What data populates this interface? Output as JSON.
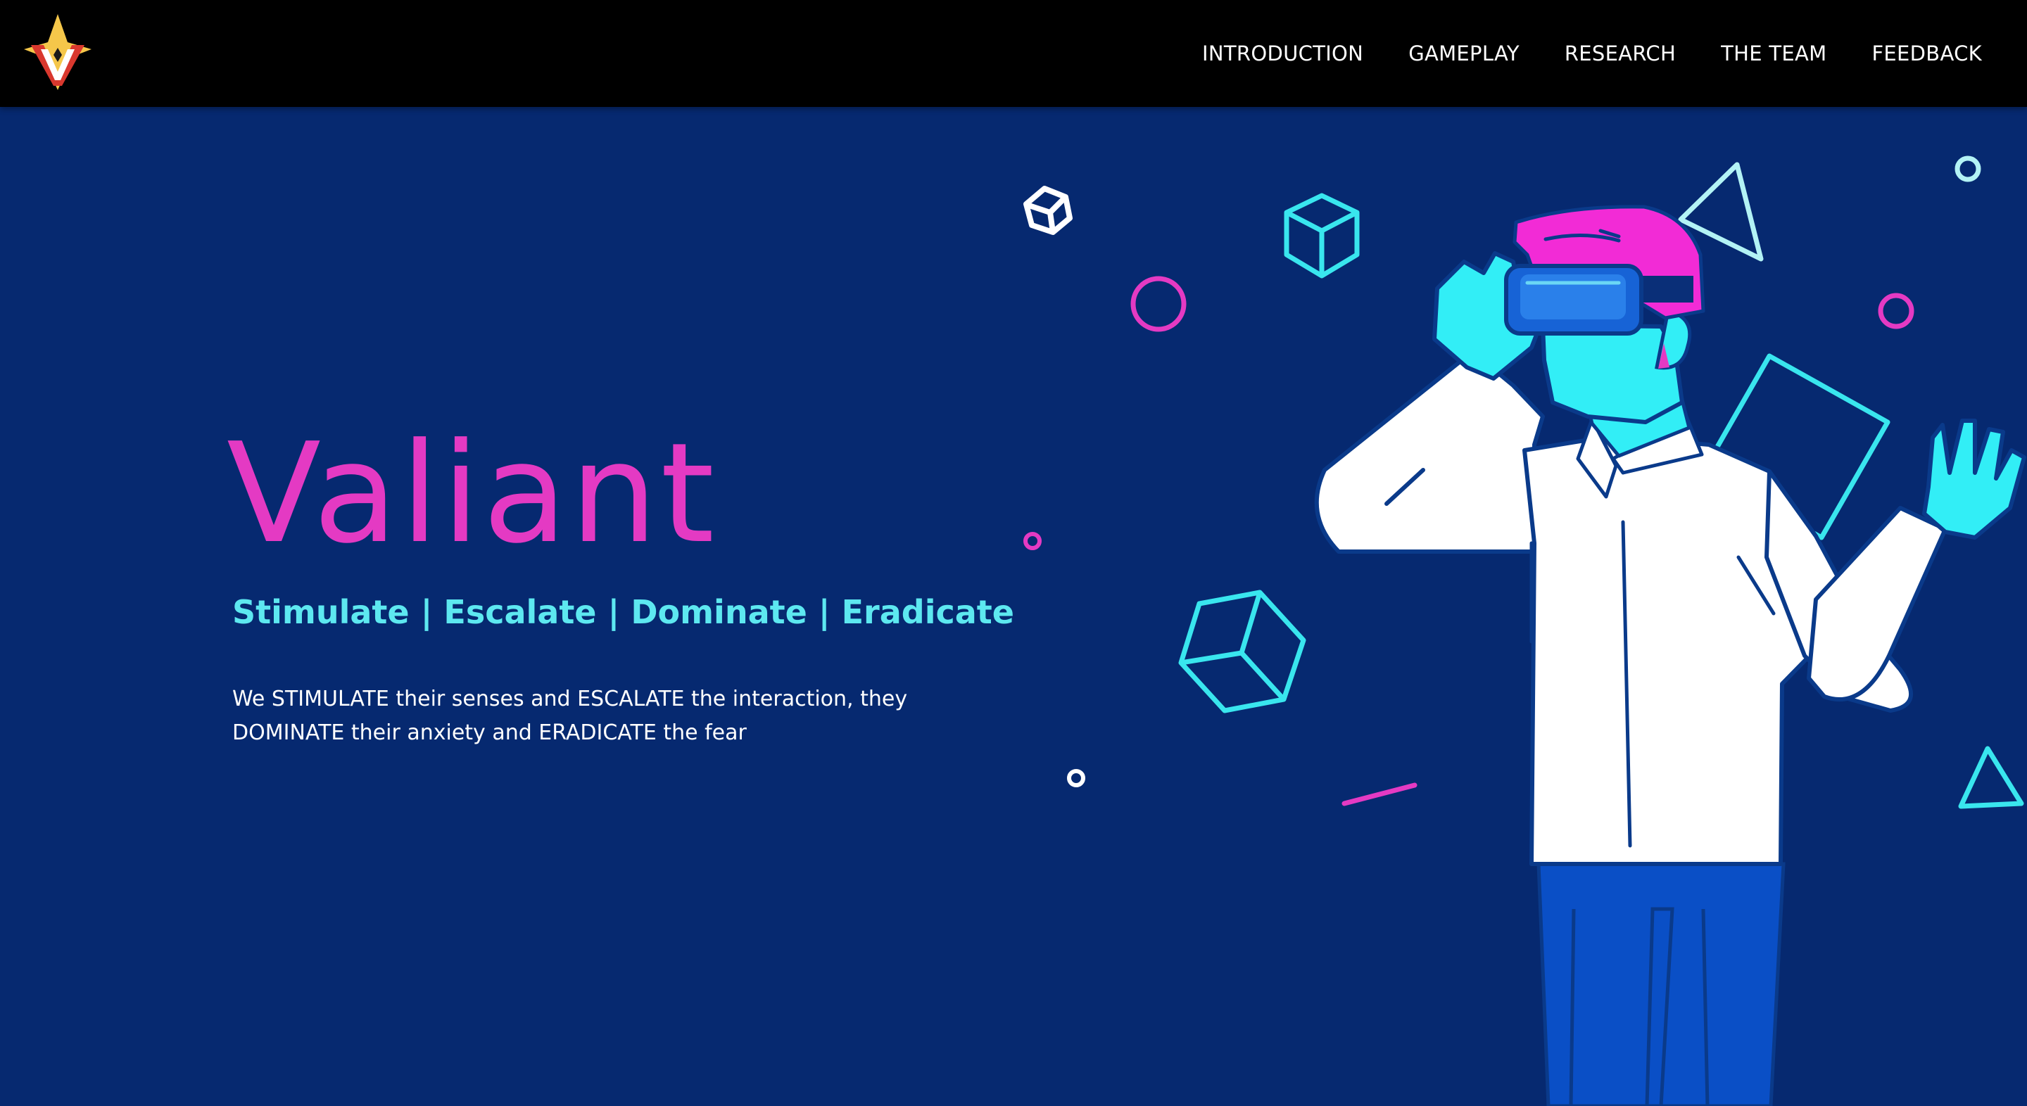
{
  "brand": {
    "logo_icon": "valiant-v-crown-logo",
    "colors": {
      "primary_bg": "#062970",
      "nav_bg": "#000000",
      "accent_pink": "#e43ac3",
      "accent_cyan": "#5de8f0",
      "logo_gold": "#f5c74a",
      "logo_red": "#d9382e"
    }
  },
  "nav": {
    "items": [
      {
        "label": "INTRODUCTION"
      },
      {
        "label": "GAMEPLAY"
      },
      {
        "label": "RESEARCH"
      },
      {
        "label": "THE TEAM"
      },
      {
        "label": "FEEDBACK"
      }
    ]
  },
  "hero": {
    "title": "Valiant",
    "subtitle": "Stimulate | Escalate | Dominate | Eradicate",
    "description": "We STIMULATE their senses and ESCALATE the interaction, they DOMINATE their anxiety and ERADICATE the fear",
    "illustration": "man-wearing-vr-headset-with-floating-geometric-shapes"
  }
}
